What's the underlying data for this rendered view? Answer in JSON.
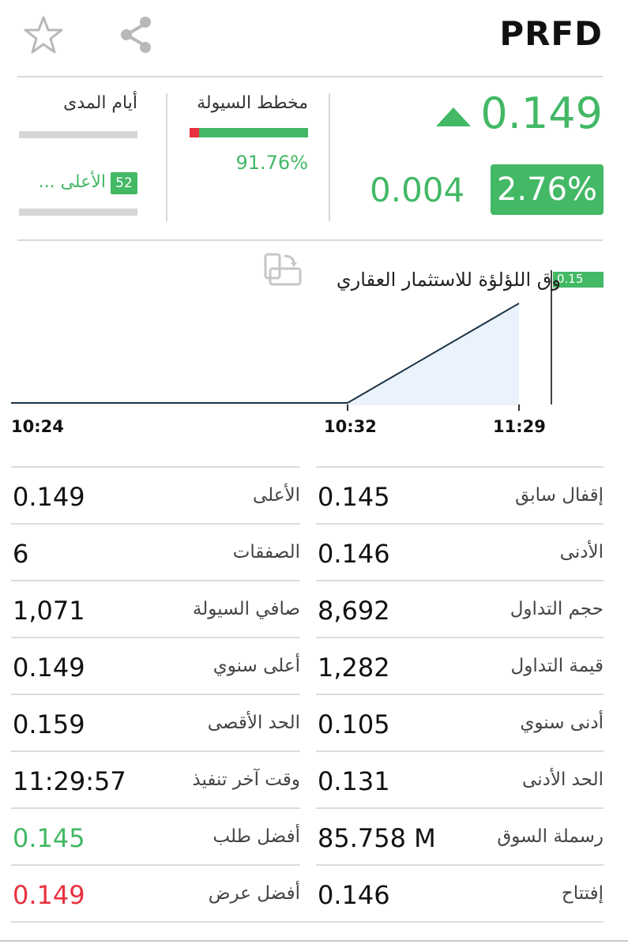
{
  "header": {
    "symbol": "PRFD",
    "star_icon": "star-outline-icon",
    "share_icon": "share-icon"
  },
  "quote": {
    "price": "0.149",
    "direction": "up",
    "change": "0.004",
    "change_percent": "2.76%",
    "color_up": "#43b865",
    "color_down": "#e8313f"
  },
  "liquidity": {
    "title": "مخطط السيولة",
    "percent": "91.76%",
    "ratio": 0.9176
  },
  "range": {
    "title": "أيام المدى",
    "badge": "52",
    "high_label": "الأعلى ..."
  },
  "chart": {
    "company_name": "وق اللؤلؤة للاستثمار العقاري",
    "rotate_icon": "rotate-device-icon",
    "price_tag": "0.15"
  },
  "chart_data": {
    "type": "area",
    "x": [
      "10:24",
      "10:32",
      "11:29"
    ],
    "values": [
      0.145,
      0.145,
      0.149
    ],
    "tick_labels": [
      "10:24",
      "10:32",
      "11:29"
    ],
    "grid": false
  },
  "stats": {
    "left": [
      {
        "label": "الأعلى",
        "value": "0.149",
        "tone": "normal"
      },
      {
        "label": "الصفقات",
        "value": "6",
        "tone": "normal"
      },
      {
        "label": "صافي السيولة",
        "value": "1,071",
        "tone": "normal"
      },
      {
        "label": "أعلى سنوي",
        "value": "0.149",
        "tone": "normal"
      },
      {
        "label": "الحد الأقصى",
        "value": "0.159",
        "tone": "normal"
      },
      {
        "label": "وقت آخر تنفيذ",
        "value": "11:29:57",
        "tone": "normal"
      },
      {
        "label": "أفضل طلب",
        "value": "0.145",
        "tone": "green"
      },
      {
        "label": "أفضل عرض",
        "value": "0.149",
        "tone": "red"
      }
    ],
    "right": [
      {
        "label": "إقفال سابق",
        "value": "0.145"
      },
      {
        "label": "الأدنى",
        "value": "0.146"
      },
      {
        "label": "حجم التداول",
        "value": "8,692"
      },
      {
        "label": "قيمة التداول",
        "value": "1,282"
      },
      {
        "label": "أدنى سنوي",
        "value": "0.105"
      },
      {
        "label": "الحد الأدنى",
        "value": "0.131"
      },
      {
        "label": "رسملة السوق",
        "value": "85.758 M"
      },
      {
        "label": "إفتتاح",
        "value": "0.146"
      }
    ]
  }
}
